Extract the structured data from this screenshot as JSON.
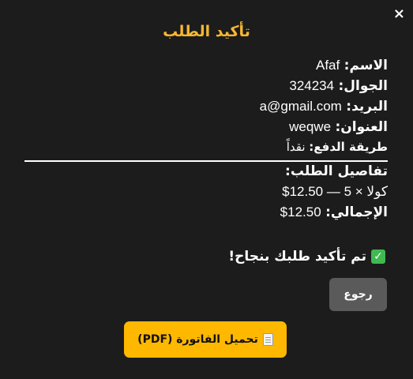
{
  "dialog": {
    "close_label": "×",
    "title": "تأكيد الطلب"
  },
  "customer": {
    "name_label": "الاسم:",
    "name": "Afaf",
    "phone_label": "الجوال:",
    "phone": "324234",
    "email_label": "البريد:",
    "email": "a@gmail.com",
    "address_label": "العنوان:",
    "address": "weqwe",
    "payment_label": "طريقة الدفع:",
    "payment": "نقداً"
  },
  "order": {
    "details_label": "تفاصيل الطلب:",
    "items": [
      {
        "text": "كولا × 5 — 12.50$"
      }
    ],
    "total_label": "الإجمالي:",
    "total": "12.50$"
  },
  "status": {
    "icon": "check-mark-icon",
    "message": "تم تأكيد طلبك بنجاح!"
  },
  "actions": {
    "back_label": "رجوع",
    "download_label": "تحميل الفاتورة (PDF)",
    "download_icon": "document-icon"
  },
  "colors": {
    "title": "#f7b733",
    "download_button": "#ffb800",
    "back_button": "#5a5a5a",
    "check": "#3fb950",
    "background": "#1c1c1c"
  }
}
